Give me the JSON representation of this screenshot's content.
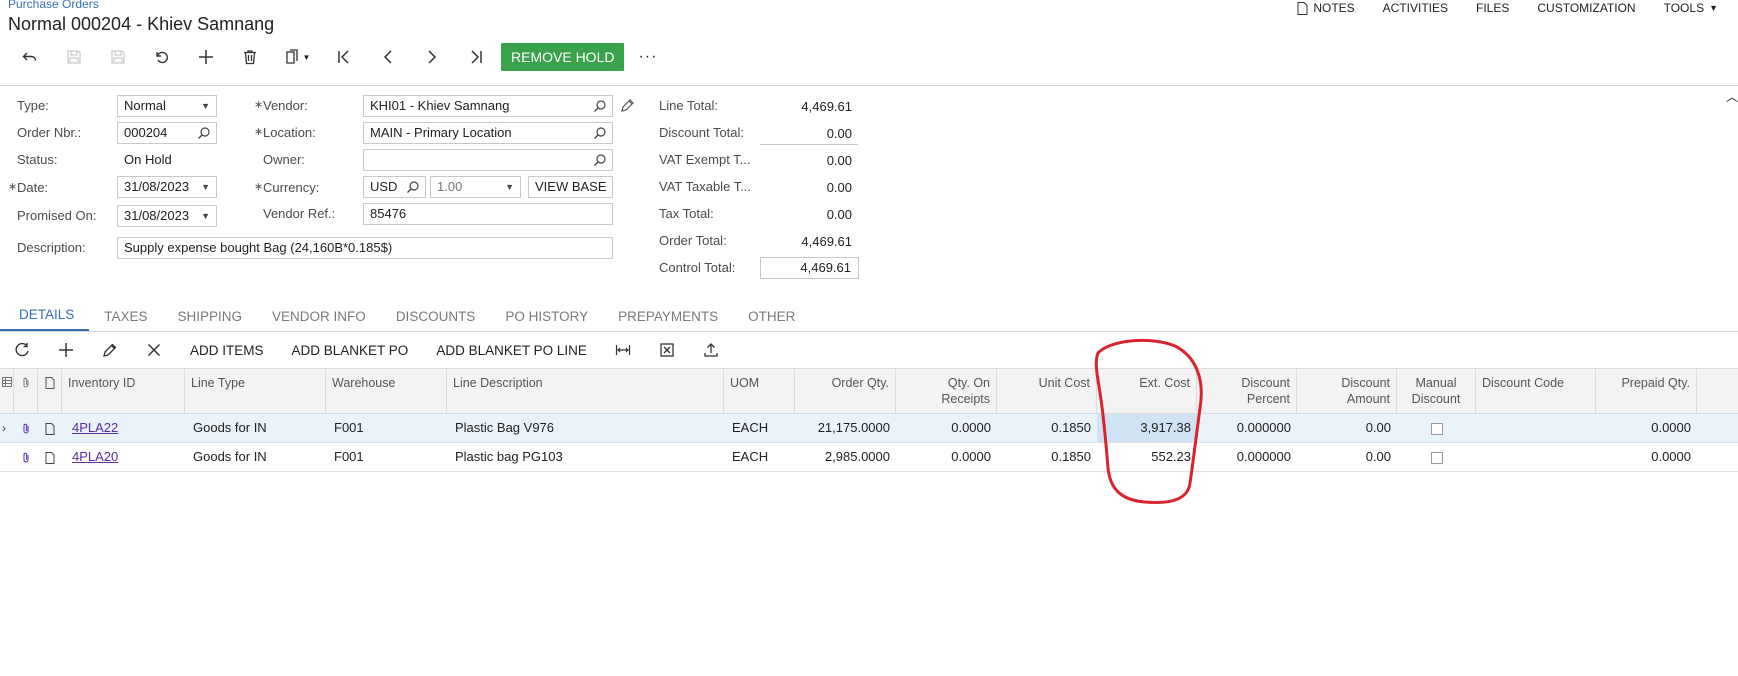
{
  "breadcrumb": "Purchase Orders",
  "title": "Normal 000204 - Khiev Samnang",
  "topnav": [
    {
      "label": "NOTES"
    },
    {
      "label": "ACTIVITIES"
    },
    {
      "label": "FILES"
    },
    {
      "label": "CUSTOMIZATION"
    },
    {
      "label": "TOOLS"
    }
  ],
  "toolbar": {
    "remove_hold": "REMOVE HOLD",
    "more": "···"
  },
  "form": {
    "type_label": "Type:",
    "type_value": "Normal",
    "order_label": "Order Nbr.:",
    "order_value": "000204",
    "status_label": "Status:",
    "status_value": "On Hold",
    "date_label": "Date:",
    "date_value": "31/08/2023",
    "promised_label": "Promised On:",
    "promised_value": "31/08/2023",
    "description_label": "Description:",
    "description_value": "Supply expense bought Bag (24,160B*0.185$)",
    "vendor_label": "Vendor:",
    "vendor_value": "KHI01 - Khiev Samnang",
    "location_label": "Location:",
    "location_value": "MAIN - Primary Location",
    "owner_label": "Owner:",
    "owner_value": "",
    "currency_label": "Currency:",
    "currency_value": "USD",
    "rate_value": "1.00",
    "view_base": "VIEW BASE",
    "vendor_ref_label": "Vendor Ref.:",
    "vendor_ref_value": "85476"
  },
  "totals": [
    {
      "label": "Line Total:",
      "value": "4,469.61"
    },
    {
      "label": "Discount Total:",
      "value": "0.00"
    },
    {
      "label": "VAT Exempt T...",
      "value": "0.00"
    },
    {
      "label": "VAT Taxable T...",
      "value": "0.00"
    },
    {
      "label": "Tax Total:",
      "value": "0.00"
    },
    {
      "label": "Order Total:",
      "value": "4,469.61"
    },
    {
      "label": "Control Total:",
      "value": "4,469.61"
    }
  ],
  "tabs": [
    {
      "label": "DETAILS"
    },
    {
      "label": "TAXES"
    },
    {
      "label": "SHIPPING"
    },
    {
      "label": "VENDOR INFO"
    },
    {
      "label": "DISCOUNTS"
    },
    {
      "label": "PO HISTORY"
    },
    {
      "label": "PREPAYMENTS"
    },
    {
      "label": "OTHER"
    }
  ],
  "grid_toolbar": {
    "add_items": "ADD ITEMS",
    "add_blanket_po": "ADD BLANKET PO",
    "add_blanket_po_line": "ADD BLANKET PO LINE"
  },
  "columns": {
    "inventory_id": "Inventory ID",
    "line_type": "Line Type",
    "warehouse": "Warehouse",
    "line_description": "Line Description",
    "uom": "UOM",
    "order_qty": "Order Qty.",
    "qty_on_receipts_1": "Qty. On",
    "qty_on_receipts_2": "Receipts",
    "unit_cost": "Unit Cost",
    "ext_cost": "Ext. Cost",
    "disc_pct_1": "Discount",
    "disc_pct_2": "Percent",
    "disc_amt_1": "Discount",
    "disc_amt_2": "Amount",
    "manual_1": "Manual",
    "manual_2": "Discount",
    "discount_code": "Discount Code",
    "prepaid_qty": "Prepaid Qty."
  },
  "rows": [
    {
      "inventory_id": "4PLA22",
      "line_type": "Goods for IN",
      "warehouse": "F001",
      "description": "Plastic Bag V976",
      "uom": "EACH",
      "order_qty": "21,175.0000",
      "qty_on_receipts": "0.0000",
      "unit_cost": "0.1850",
      "ext_cost": "3,917.38",
      "discount_percent": "0.000000",
      "discount_amount": "0.00",
      "manual_discount": false,
      "discount_code": "",
      "prepaid_qty": "0.0000"
    },
    {
      "inventory_id": "4PLA20",
      "line_type": "Goods for IN",
      "warehouse": "F001",
      "description": "Plastic bag PG103",
      "uom": "EACH",
      "order_qty": "2,985.0000",
      "qty_on_receipts": "0.0000",
      "unit_cost": "0.1850",
      "ext_cost": "552.23",
      "discount_percent": "0.000000",
      "discount_amount": "0.00",
      "manual_discount": false,
      "discount_code": "",
      "prepaid_qty": "0.0000"
    }
  ],
  "colors": {
    "accent": "#3a6fb0",
    "green": "#3aa24a",
    "annotation": "#d9232d"
  }
}
